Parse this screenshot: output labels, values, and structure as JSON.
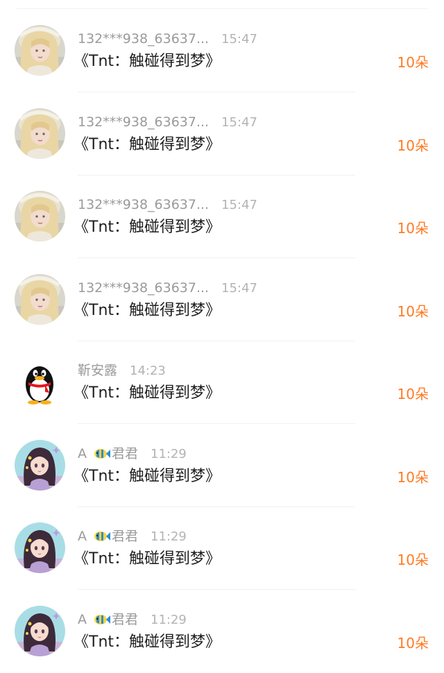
{
  "colors": {
    "accent": "#ff7a22",
    "username": "#9a9a9a",
    "time": "#b3b3b3",
    "message": "#1e1e1e"
  },
  "gifts": [
    {
      "avatar": "blonde-girl-avatar",
      "username": "132***938_63637...",
      "time": "15:47",
      "message": "《Tnt：触碰得到梦》",
      "amount": "10朵"
    },
    {
      "avatar": "blonde-girl-avatar",
      "username": "132***938_63637...",
      "time": "15:47",
      "message": "《Tnt：触碰得到梦》",
      "amount": "10朵"
    },
    {
      "avatar": "blonde-girl-avatar",
      "username": "132***938_63637...",
      "time": "15:47",
      "message": "《Tnt：触碰得到梦》",
      "amount": "10朵"
    },
    {
      "avatar": "blonde-girl-avatar",
      "username": "132***938_63637...",
      "time": "15:47",
      "message": "《Tnt：触碰得到梦》",
      "amount": "10朵"
    },
    {
      "avatar": "qq-penguin-avatar",
      "username": "靳安露",
      "time": "14:23",
      "message": "《Tnt：触碰得到梦》",
      "amount": "10朵"
    },
    {
      "avatar": "anime-girl-avatar",
      "username_prefix": "A",
      "username_icon": "fish-icon",
      "username": "君君",
      "time": "11:29",
      "message": "《Tnt：触碰得到梦》",
      "amount": "10朵"
    },
    {
      "avatar": "anime-girl-avatar",
      "username_prefix": "A",
      "username_icon": "fish-icon",
      "username": "君君",
      "time": "11:29",
      "message": "《Tnt：触碰得到梦》",
      "amount": "10朵"
    },
    {
      "avatar": "anime-girl-avatar",
      "username_prefix": "A",
      "username_icon": "fish-icon",
      "username": "君君",
      "time": "11:29",
      "message": "《Tnt：触碰得到梦》",
      "amount": "10朵"
    }
  ]
}
